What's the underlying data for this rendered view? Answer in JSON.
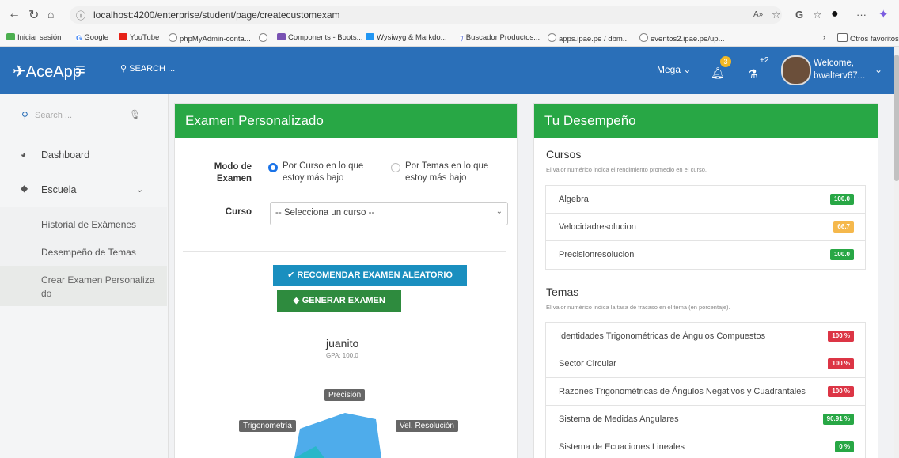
{
  "browser": {
    "url": "localhost:4200/enterprise/student/page/createcustomexam",
    "bookmarks": [
      "Iniciar sesión",
      "Google",
      "YouTube",
      "phpMyAdmin-conta...",
      "Components - Boots...",
      "Wysiwyg & Markdo...",
      "Buscador Productos...",
      "apps.ipae.pe / dbm...",
      "eventos2.ipae.pe/up..."
    ],
    "other_favorites": "Otros favoritos"
  },
  "navbar": {
    "brand": "AceApp",
    "search": "SEARCH ...",
    "mega": "Mega",
    "notif_count": "3",
    "lab_count": "+2",
    "welcome_line1": "Welcome,",
    "welcome_line2": "bwalterv67..."
  },
  "sidebar": {
    "search_placeholder": "Search ...",
    "items": [
      {
        "label": "Dashboard"
      },
      {
        "label": "Escuela"
      }
    ],
    "sub_items": [
      "Historial de Exámenes",
      "Desempeño de Temas",
      "Crear Examen Personaliza",
      "do"
    ]
  },
  "exam_card": {
    "title": "Examen Personalizado",
    "mode_label_1": "Modo de",
    "mode_label_2": "Examen",
    "option1_line1": "Por Curso en lo que",
    "option1_line2": "estoy más bajo",
    "option2_line1": "Por Temas en lo que",
    "option2_line2": "estoy más bajo",
    "course_label": "Curso",
    "course_select": "-- Selecciona un curso --",
    "recommend_button": "RECOMENDAR EXAMEN ALEATORIO",
    "generate_button": "GENERAR EXAMEN",
    "student_name": "juanito",
    "gpa": "GPA: 100.0",
    "radar_labels": [
      "Precisión",
      "Trigonometría",
      "Vel. Resolución"
    ]
  },
  "performance_card": {
    "title": "Tu Desempeño",
    "courses_title": "Cursos",
    "courses_note": "El valor numérico indica el rendimiento promedio en el curso.",
    "courses": [
      {
        "name": "Algebra",
        "value": "100.0",
        "color": "#28a745"
      },
      {
        "name": "Velocidadresolucion",
        "value": "66.7",
        "color": "#f5b84c"
      },
      {
        "name": "Precisionresolucion",
        "value": "100.0",
        "color": "#28a745"
      }
    ],
    "topics_title": "Temas",
    "topics_note": "El valor numérico indica la tasa de fracaso en el tema (en porcentaje).",
    "topics": [
      {
        "name": "Identidades Trigonométricas de Ángulos Compuestos",
        "value": "100 %",
        "color": "#dc3545"
      },
      {
        "name": "Sector Circular",
        "value": "100 %",
        "color": "#dc3545"
      },
      {
        "name": "Razones Trigonométricas de Ángulos Negativos y Cuadrantales",
        "value": "100 %",
        "color": "#dc3545"
      },
      {
        "name": "Sistema de Medidas Angulares",
        "value": "90.91 %",
        "color": "#28a745"
      },
      {
        "name": "Sistema de Ecuaciones Lineales",
        "value": "0 %",
        "color": "#28a745"
      }
    ]
  }
}
